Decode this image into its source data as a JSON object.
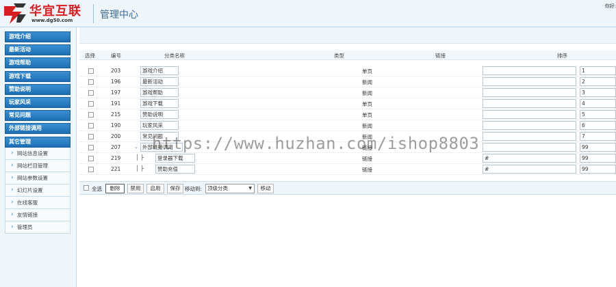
{
  "header": {
    "brand": "华宜互联",
    "brand_url": "www.dg50.com",
    "app_title": "管理中心",
    "greeting": "你好:"
  },
  "sidebar": {
    "menus": [
      {
        "label": "游戏介绍"
      },
      {
        "label": "最新活动"
      },
      {
        "label": "游戏帮助"
      },
      {
        "label": "游戏下载"
      },
      {
        "label": "赞助说明"
      },
      {
        "label": "玩家风采"
      },
      {
        "label": "常见问题"
      },
      {
        "label": "外部链接调用"
      },
      {
        "label": "其它管理"
      }
    ],
    "submenu": [
      {
        "label": "网站信息设置"
      },
      {
        "label": "网站栏目管理"
      },
      {
        "label": "网站参数设置"
      },
      {
        "label": "幻灯片设置"
      },
      {
        "label": "在线客服"
      },
      {
        "label": "友情链接"
      },
      {
        "label": "管理员"
      }
    ]
  },
  "table": {
    "headers": {
      "select": "选择",
      "id": "编号",
      "name": "分类名称",
      "type": "类型",
      "link": "链接",
      "sort": "排序"
    },
    "rows": [
      {
        "id": "203",
        "name": "游戏介绍",
        "type": "单页",
        "link": "",
        "sort": "1"
      },
      {
        "id": "196",
        "name": "最新活动",
        "type": "新闻",
        "link": "",
        "sort": "2"
      },
      {
        "id": "197",
        "name": "游戏帮助",
        "type": "新闻",
        "link": "",
        "sort": "3"
      },
      {
        "id": "191",
        "name": "游戏下载",
        "type": "单页",
        "link": "",
        "sort": "4"
      },
      {
        "id": "215",
        "name": "赞助说明",
        "type": "单页",
        "link": "",
        "sort": "5"
      },
      {
        "id": "190",
        "name": "玩家风采",
        "type": "新闻",
        "link": "",
        "sort": "6"
      },
      {
        "id": "200",
        "name": "常见问题",
        "type": "新闻",
        "link": "",
        "sort": "7"
      },
      {
        "id": "207",
        "name": "外部链接调用",
        "type": "链接",
        "link": "",
        "sort": "99"
      },
      {
        "id": "219",
        "name": "登录器下载",
        "type": "链接",
        "link": "#",
        "sort": "99",
        "tree": "│ ├"
      },
      {
        "id": "221",
        "name": "赞助充值",
        "type": "链接",
        "link": "#",
        "sort": "99",
        "tree": "│ ├"
      }
    ]
  },
  "bottom_bar": {
    "select_all": "全选",
    "delete": "删除",
    "disable": "禁用",
    "enable": "启用",
    "save": "保存",
    "move_to": "移动到:",
    "move_target": "顶级分类",
    "move": "移动"
  },
  "watermark": "https://www.huzhan.com/ishop8803",
  "colors": {
    "brand_red": "#d81e1e",
    "menu_blue": "#1d6fb5",
    "title_blue": "#3d6c97",
    "panel_bg": "#eef5fb"
  }
}
